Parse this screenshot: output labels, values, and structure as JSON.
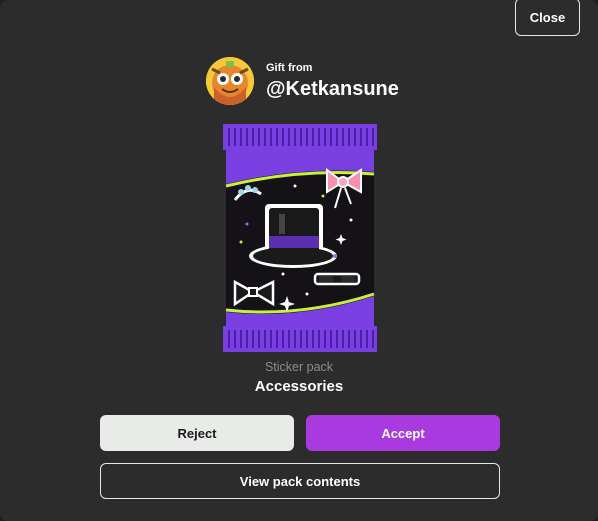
{
  "dialog": {
    "close_label": "Close"
  },
  "sender": {
    "prefix": "Gift from",
    "username": "@Ketkansune"
  },
  "pack": {
    "type_label": "Sticker pack",
    "name": "Accessories"
  },
  "actions": {
    "reject_label": "Reject",
    "accept_label": "Accept",
    "view_label": "View pack contents"
  },
  "colors": {
    "accent": "#a83ae0",
    "background": "#2b2c2b",
    "pack_purple": "#7a3fe0"
  }
}
